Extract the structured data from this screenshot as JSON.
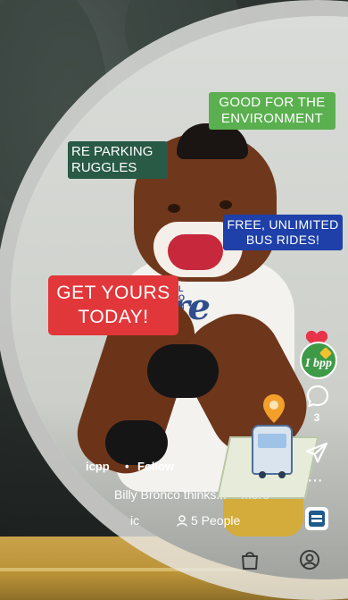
{
  "stickers": {
    "green_line1": "GOOD FOR THE",
    "green_line2": "ENVIRONMENT",
    "dark_line1": "RE PARKING",
    "dark_line2": "RUGGLES",
    "blue_line1": "FREE, UNLIMITED",
    "blue_line2": "BUS RIDES!",
    "red_line1": "GET YOURS",
    "red_line2": "TODAY!"
  },
  "mascot": {
    "shirt_text": "ere",
    "shirt_top_text": "L O N G"
  },
  "rail": {
    "comment_count": "3",
    "avatar_text": "I ",
    "avatar_sub": "bpp"
  },
  "post": {
    "username": "icpp",
    "separator": "•",
    "follow_label": "Follow",
    "caption": "Billy Bronco thinks...",
    "more_label": "more",
    "audio_label": "ic",
    "people_label": "5 People"
  },
  "colors": {
    "green_sticker": "#5ab04f",
    "dark_sticker": "#285a46",
    "blue_sticker": "#1e40a8",
    "red_sticker": "#e2373a",
    "like_red": "#e8344a",
    "pin_orange": "#f2a02a"
  },
  "icons": {
    "like": "heart-icon",
    "comment": "comment-bubble-icon",
    "share": "paper-plane-icon",
    "more": "more-dots-icon",
    "audio": "audio-thumbnail-icon",
    "people": "person-icon",
    "location": "map-pin-icon",
    "nav_shop": "shopping-bag-icon",
    "nav_profile": "profile-icon"
  }
}
